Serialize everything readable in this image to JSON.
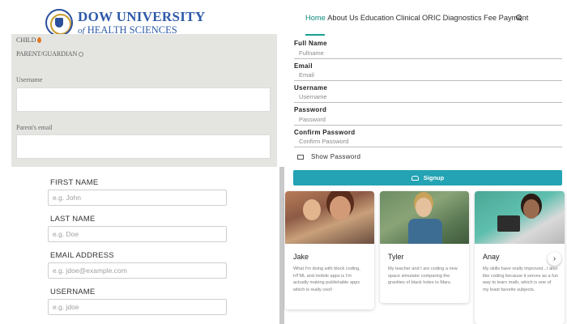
{
  "header": {
    "logo_line1": "DOW UNIVERSITY",
    "logo_line2_of": "of",
    "logo_line2_rest": "HEALTH SCIENCES",
    "nav": [
      "Home",
      "About Us",
      "Education",
      "Clinical",
      "ORIC",
      "Diagnostics",
      "Fee Payment"
    ],
    "active_nav": "Home",
    "search_icon": "search-icon"
  },
  "left_panel": {
    "child_label": "CHILD",
    "parent_label": "PARENT/GUARDIAN",
    "username_label": "Username",
    "parent_email_label": "Parent's email"
  },
  "left_form": {
    "first_name": {
      "label": "FIRST NAME",
      "placeholder": "e.g. John"
    },
    "last_name": {
      "label": "LAST NAME",
      "placeholder": "e.g. Doe"
    },
    "email": {
      "label": "EMAIL ADDRESS",
      "placeholder": "e.g. jdoe@example.com"
    },
    "username": {
      "label": "USERNAME",
      "placeholder": "e.g. jdoe"
    }
  },
  "signup_form": {
    "full_name": {
      "label": "Full Name",
      "placeholder": "Fullname"
    },
    "email": {
      "label": "Email",
      "placeholder": "Email"
    },
    "username": {
      "label": "Username",
      "placeholder": "Username"
    },
    "password": {
      "label": "Password",
      "placeholder": "Password"
    },
    "confirm_password": {
      "label": "Confirm Password",
      "placeholder": "Confirm Password"
    },
    "show_password": "Show Password",
    "signup_button": "Signup"
  },
  "testimonials": [
    {
      "name": "Jake",
      "quote": "What I'm doing with block coding, HTML and mobile apps is I'm actually making publishable apps which is really cool!"
    },
    {
      "name": "Tyler",
      "quote": "My teacher and I are coding a new space simulator comparing the gravities of black holes to Mars."
    },
    {
      "name": "Anay",
      "quote": "My skills have really improved...I also like coding because it serves as a fun way to learn math, which is one of my least favorite subjects."
    }
  ],
  "colors": {
    "accent": "#23a3b3",
    "nav_active": "#0e8a7d",
    "logo_blue": "#2d5aa8",
    "panel_gray": "#e4e4e1"
  }
}
